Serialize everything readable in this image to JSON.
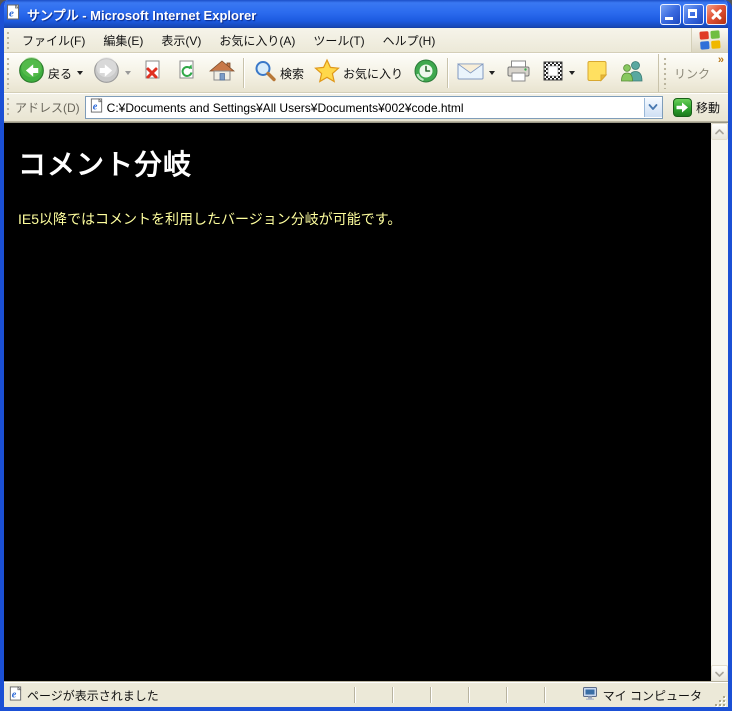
{
  "window": {
    "title": "サンプル - Microsoft Internet Explorer"
  },
  "menubar": {
    "items": [
      {
        "label": "ファイル(F)"
      },
      {
        "label": "編集(E)"
      },
      {
        "label": "表示(V)"
      },
      {
        "label": "お気に入り(A)"
      },
      {
        "label": "ツール(T)"
      },
      {
        "label": "ヘルプ(H)"
      }
    ]
  },
  "toolbar": {
    "back": {
      "label": "戻る"
    },
    "search": {
      "label": "検索"
    },
    "favorites": {
      "label": "お気に入り"
    },
    "links": {
      "label": "リンク",
      "chevron": "»"
    }
  },
  "addressbar": {
    "label": "アドレス(D)",
    "value": "C:¥Documents and Settings¥All Users¥Documents¥002¥code.html",
    "go_label": "移動"
  },
  "content": {
    "heading": "コメント分岐",
    "body": "IE5以降ではコメントを利用したバージョン分岐が可能です。",
    "colors": {
      "background": "#000000",
      "heading": "#ffffff",
      "body": "#ffff9e"
    }
  },
  "statusbar": {
    "message": "ページが表示されました",
    "zone": "マイ コンピュータ"
  },
  "colors": {
    "titlebar_blue": "#1c5ae0",
    "window_border": "#1b50d5",
    "chrome_beige": "#ece9d8",
    "address_field_border": "#7f9db9",
    "go_green": "#2ca32c",
    "back_green": "#3fae3f"
  }
}
